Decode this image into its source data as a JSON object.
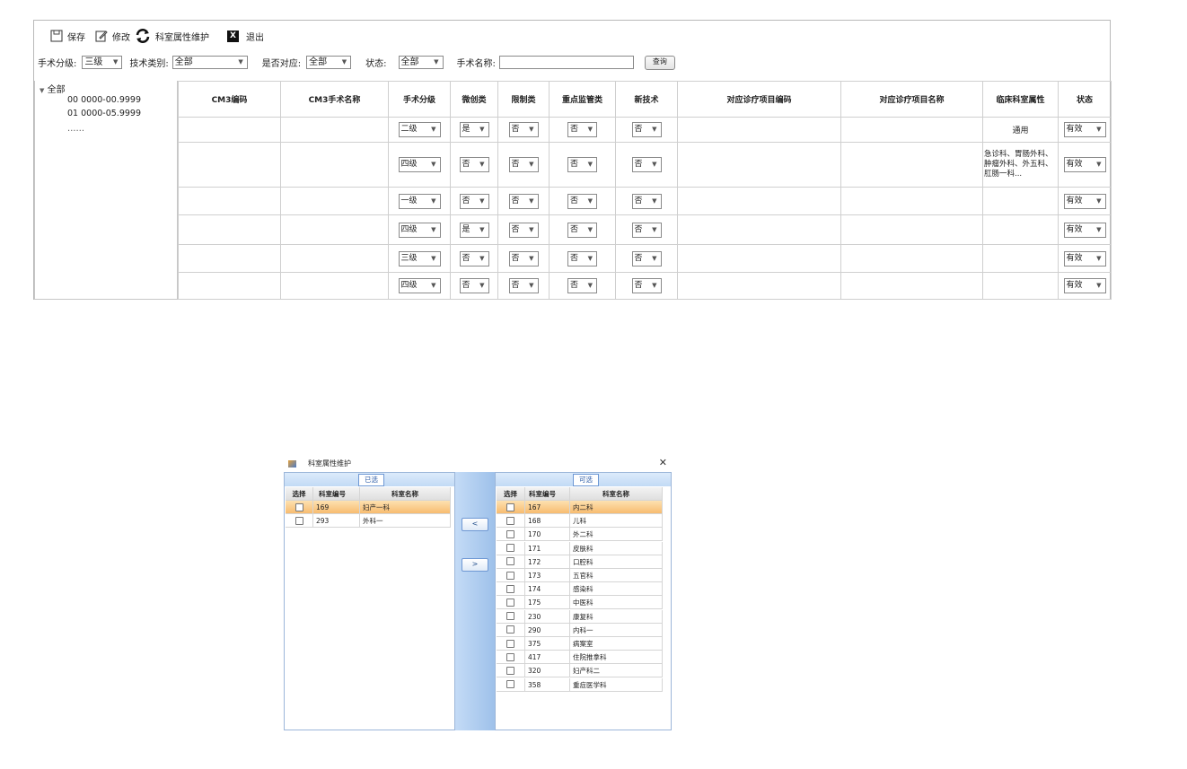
{
  "toolbar": {
    "save_label": "保存",
    "edit_label": "修改",
    "dept_attr_label": "科室属性维护",
    "exit_label": "退出",
    "exit_glyph": "X"
  },
  "filters": {
    "level_label": "手术分级:",
    "level_value": "三级",
    "tech_label": "技术类别:",
    "tech_value": "全部",
    "match_label": "是否对应:",
    "match_value": "全部",
    "status_label": "状态:",
    "status_value": "全部",
    "name_label": "手术名称:",
    "name_value": "",
    "query_label": "查询"
  },
  "tree": {
    "root": "全部",
    "nodes": [
      "00 0000-00.9999",
      "01 0000-05.9999",
      "……"
    ]
  },
  "grid": {
    "headers": [
      "CM3编码",
      "CM3手术名称",
      "手术分级",
      "微创类",
      "限制类",
      "重点监管类",
      "新技术",
      "对应诊疗项目编码",
      "对应诊疗项目名称",
      "临床科室属性",
      "状态"
    ],
    "rows": [
      {
        "level": "二级",
        "minimal": "是",
        "limited": "否",
        "key": "否",
        "newtech": "否",
        "dept": "通用",
        "status": "有效"
      },
      {
        "level": "四级",
        "minimal": "否",
        "limited": "否",
        "key": "否",
        "newtech": "否",
        "dept": "急诊科、胃肠外科、肿瘤外科、外五科、肛肠一科...",
        "status": "有效"
      },
      {
        "level": "一级",
        "minimal": "否",
        "limited": "否",
        "key": "否",
        "newtech": "否",
        "dept": "",
        "status": "有效"
      },
      {
        "level": "四级",
        "minimal": "是",
        "limited": "否",
        "key": "否",
        "newtech": "否",
        "dept": "",
        "status": "有效"
      },
      {
        "level": "三级",
        "minimal": "否",
        "limited": "否",
        "key": "否",
        "newtech": "否",
        "dept": "",
        "status": "有效"
      },
      {
        "level": "四级",
        "minimal": "否",
        "limited": "否",
        "key": "否",
        "newtech": "否",
        "dept": "",
        "status": "有效"
      }
    ]
  },
  "dialog": {
    "title": "科室属性维护",
    "selected_caption": "已选",
    "available_caption": "可选",
    "col_select": "选择",
    "col_code": "科室编号",
    "col_name": "科室名称",
    "move_left": "<",
    "move_right": ">",
    "selected": [
      {
        "code": "169",
        "name": "妇产一科",
        "highlight": true
      },
      {
        "code": "293",
        "name": "外科一",
        "highlight": false
      }
    ],
    "available": [
      {
        "code": "167",
        "name": "内二科",
        "highlight": true
      },
      {
        "code": "168",
        "name": "儿科"
      },
      {
        "code": "170",
        "name": "外二科"
      },
      {
        "code": "171",
        "name": "皮肤科"
      },
      {
        "code": "172",
        "name": "口腔科"
      },
      {
        "code": "173",
        "name": "五官科"
      },
      {
        "code": "174",
        "name": "感染科"
      },
      {
        "code": "175",
        "name": "中医科"
      },
      {
        "code": "230",
        "name": "康复科"
      },
      {
        "code": "290",
        "name": "内科一"
      },
      {
        "code": "375",
        "name": "病案室"
      },
      {
        "code": "417",
        "name": "住院推拿科"
      },
      {
        "code": "320",
        "name": "妇产科二"
      },
      {
        "code": "358",
        "name": "重症医学科"
      }
    ]
  }
}
